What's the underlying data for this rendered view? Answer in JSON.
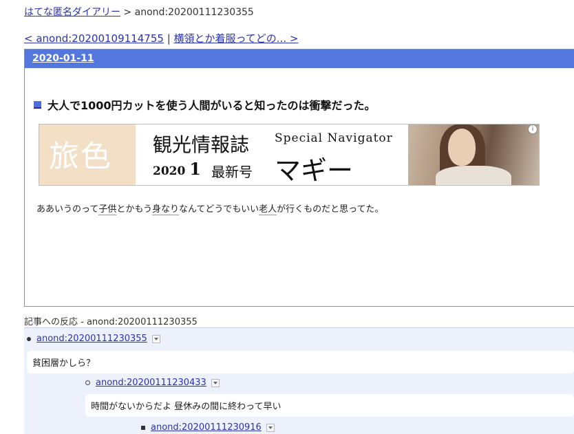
{
  "breadcrumb": {
    "site_link": "はてな匿名ダイアリー",
    "separator": ">",
    "current": "anond:20200111230355"
  },
  "pager": {
    "prev_link": "< anond:20200109114755",
    "divider": "|",
    "next_link": "横領とか着服ってどの... >"
  },
  "day": {
    "date_link": "2020-01-11",
    "section_title": "大人で1000円カットを使う人間がいると知ったのは衝撃だった。",
    "body_parts": [
      "ああいうのって",
      "子供",
      "とかもう",
      "身なり",
      "なんてどうでもいい",
      "老人",
      "が行くものだと思ってた。"
    ]
  },
  "ad": {
    "brand": "旅色",
    "headline": "観光情報誌",
    "year": "2020",
    "month": "1",
    "issue": "最新号",
    "tagline": "Special Navigator",
    "name": "マギー",
    "info_glyph": "i"
  },
  "reactions": {
    "heading": "記事への反応 - anond:20200111230355",
    "items": [
      {
        "id": "anond:20200111230355",
        "text": "貧困層かしら？"
      },
      {
        "id": "anond:20200111230433",
        "text": "時間がないからだよ 昼休みの間に終わって早い"
      },
      {
        "id": "anond:20200111230916",
        "text": ""
      }
    ]
  },
  "colors": {
    "accent": "#5477de",
    "link": "#2b32b2",
    "reaction_bg": "#edf1fb"
  },
  "icons": {
    "section_marker": "square-icon",
    "dropdown": "chevron-down-icon"
  }
}
